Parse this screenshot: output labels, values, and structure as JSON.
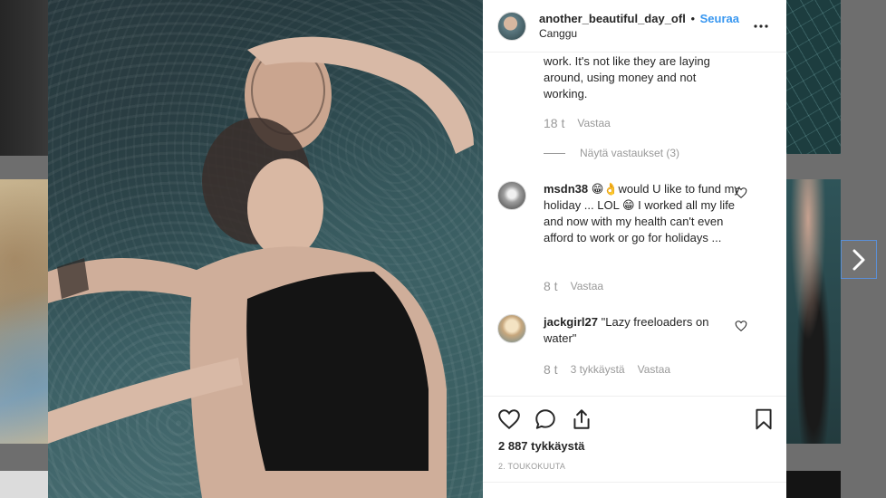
{
  "post": {
    "username": "another_beautiful_day_ofl",
    "separator": "•",
    "follow_label": "Seuraa",
    "location": "Canggu",
    "more_icon": "more-options-icon"
  },
  "comments": {
    "partial_reply": {
      "text": "work. It's not like they are laying around, using money and not working.",
      "time": "18 t",
      "reply_label": "Vastaa"
    },
    "view_replies_label": "Näytä vastaukset (3)",
    "items": [
      {
        "user": "msdn38",
        "text": "😁👌would U like to fund my holiday ... LOL 😁 I worked all my life and now with my health can't even afford to work or go for holidays ...",
        "time": "8 t",
        "likes": "",
        "reply_label": "Vastaa"
      },
      {
        "user": "jackgirl27",
        "text": "\"Lazy freeloaders on water\"",
        "time": "8 t",
        "likes": "3 tykkäystä",
        "reply_label": "Vastaa"
      }
    ]
  },
  "actions": {
    "icons": [
      "heart-icon",
      "comment-icon",
      "share-icon",
      "bookmark-icon"
    ],
    "likes_count": "2 887 tykkäystä",
    "date": "2. TOUKOKUUTA"
  },
  "colors": {
    "link_blue": "#3897f0",
    "meta_gray": "#999999",
    "text": "#262626",
    "overlay": "#6e6e6e"
  }
}
